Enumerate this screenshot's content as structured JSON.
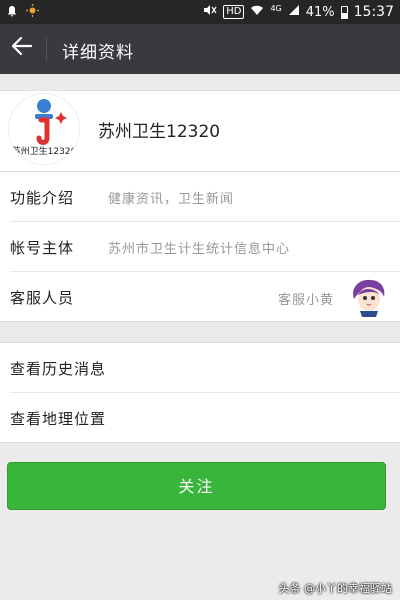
{
  "status_bar": {
    "hd_badge": "HD",
    "network": "4G",
    "battery": "41%",
    "time": "15:37"
  },
  "header": {
    "title": "详细资料"
  },
  "profile": {
    "name": "苏州卫生12320",
    "avatar_caption": "苏州卫生12320"
  },
  "info_rows": [
    {
      "label": "功能介绍",
      "value": "健康资讯，卫生新闻"
    },
    {
      "label": "帐号主体",
      "value": "苏州市卫生计生统计信息中心"
    },
    {
      "label": "客服人员",
      "value": "客服小黄"
    }
  ],
  "actions": [
    {
      "label": "查看历史消息"
    },
    {
      "label": "查看地理位置"
    }
  ],
  "follow_button": {
    "label": "关注"
  },
  "watermark": "头条 @小丫的幸福驿站",
  "colors": {
    "header_bg": "#393a3f",
    "button_green": "#3ab53c"
  }
}
